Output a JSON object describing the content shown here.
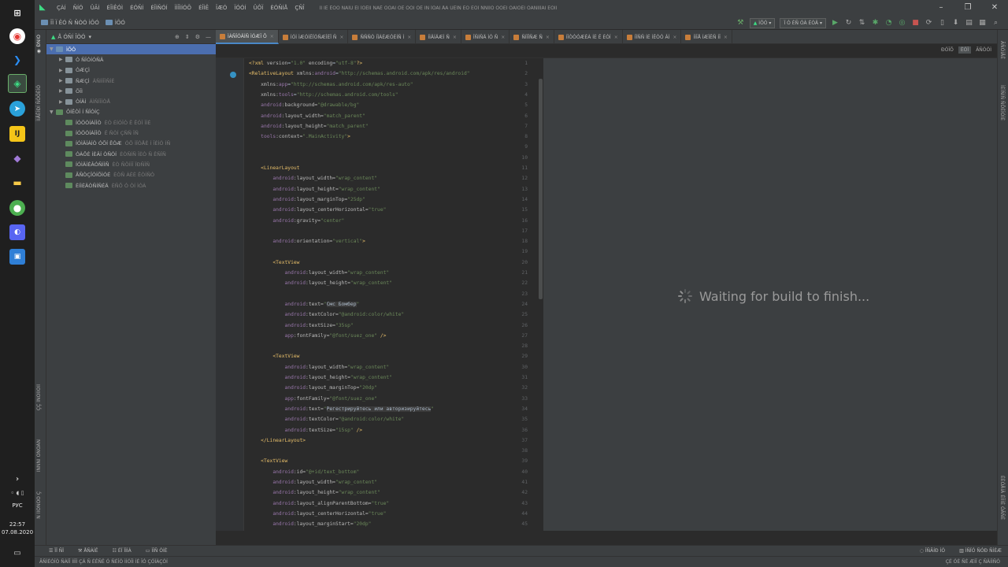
{
  "taskbar": {
    "language": "РУС",
    "time": "22:57",
    "date": "07.08.2020"
  },
  "menu": {
    "title": "ÏÌ ÍÈ ËÒÓ ÑÀÏÛ ÈÍ ÏÒËÎÌ ÑÀË ÓÓÀÍ ÓÉ ÓÒÌ ÓÊ ÌÑ ÏÒÁÌ ÅÂ ÛÊÏÑ ÈÒ ÈÓÏ ÑÑÌÎÕ ÓÒÊÌ ÓÁÍÓÊÌ ÓÀÑÎÍÏÁÍ ÈÓÍÍ"
  },
  "nav": {
    "crumb1": "ÏÏ Ï ÊÓ Ñ ÑÒÓ ÌÕÓ",
    "crumb2": "ÌÕÓ",
    "run_config": "ÌÕÓ",
    "device": "Ï Ó ÈÑ ÓÀ ÉÓÄ"
  },
  "project_panel": {
    "title": "Å ÓÑÍ ÎÒÓ",
    "tree": [
      {
        "label": "ÌÕÓ",
        "sel": true,
        "open": true,
        "depth": 0,
        "icon": "blue"
      },
      {
        "label": "Ó ÑÎÓÍÓÑÄ",
        "depth": 1,
        "icon": "plain"
      },
      {
        "label": "ÓÆÇÌ",
        "depth": 1,
        "icon": "plain"
      },
      {
        "label": "ÑÆÇÌ",
        "dim": "ÄÑÍÍÎÌÑÍÈ",
        "depth": 1,
        "icon": "plain"
      },
      {
        "label": "ÕÎÌ",
        "depth": 1,
        "icon": "plain"
      },
      {
        "label": "ÒÍÄÌ",
        "dim": "ÄÌÑÍÎÌÒÅ",
        "depth": 1,
        "icon": "plain"
      },
      {
        "label": "ÔÍÊÒÎ Í ÑÏÓÍÇ",
        "open": true,
        "depth": 0,
        "icon": "gradle"
      },
      {
        "label": "ÍÓÖÓÍÀÌÎÒ",
        "dim": "ÈÒ ÉÍÓÎÒ Ê ÊÓÎ ÎÍÈ",
        "depth": 1,
        "icon": "gradle"
      },
      {
        "label": "ÍÓÖÓÍÀÌÎÒ",
        "dim": "Ê ÑÒÍ ÇÑÑ ÎÑ",
        "depth": 1,
        "icon": "gradle"
      },
      {
        "label": "ÍÓÌÄÍÁÍÒ ÓÕÍ ÊÓÆ",
        "dim": "ÓÕ ÌÏÒÅÈ Í ÎÉÌÓ ÍÑ",
        "depth": 1,
        "icon": "gradle"
      },
      {
        "label": "ÓÀÔÈ ÍÈÂÍ ÒÑÓÍ",
        "dim": "ÈÒÑÍÑ ÎÈÒ Ñ ÊÑÎÑ",
        "depth": 1,
        "icon": "gradle"
      },
      {
        "label": "ÍÓÌÄÍÉÂÓÑÍÍÑ",
        "dim": "ÈÒ ÑÖÍÍÎ ÏÐÑÎÑ",
        "depth": 1,
        "icon": "gradle"
      },
      {
        "label": "ÃÑÒÇÎÓÍÕÌÓÉ",
        "dim": "ÈÒÑ ÁÈÈ ÊÒÍÑÓ",
        "depth": 1,
        "icon": "gradle"
      },
      {
        "label": "ÈÍÌÈÄÒÑÍÑÉÄ",
        "dim": "ÈÑÕ Ó ÒÍ ÌÓÀ",
        "depth": 1,
        "icon": "gradle"
      }
    ]
  },
  "tabs": [
    {
      "label": "ÌÀÑÎÓÄÍÑ ÌÓÆÎ Ô",
      "active": true
    },
    {
      "label": "ÍÓÌ ÌÆÓÍÊÏÓÑÆÎÈÏ Ñ"
    },
    {
      "label": "ÑÑÑÒ ÍÏÁÈÆÓÈÍÑ Ì"
    },
    {
      "label": "ÍÌÄÍÄÆÌ Ñ"
    },
    {
      "label": "ÎÑÍÑÄ ÌÓ Ñ"
    },
    {
      "label": "ÑÍÏÎÑÆ Ñ"
    },
    {
      "label": "ÍÏÒÒÓÆÈÀ ÍÈ Ê ÈÓÍ"
    },
    {
      "label": "ÍÏÑÑ ÍÉ ÍÊÒÓ ÂÍ"
    },
    {
      "label": "ÍÌÎÅ ÍÆÎÊÑ ÍÎ"
    }
  ],
  "modes": [
    "ÐÓÎÕ",
    "ÈÓÎ",
    "ÃÑÒÓÌ"
  ],
  "editor": {
    "lines": [
      {
        "n": "1",
        "h": "<span class=\"t\">&lt;?xml</span> <span class=\"a\">version</span>=<span class=\"v\">\"1.0\"</span> <span class=\"a\">encoding</span>=<span class=\"v\">\"utf-8\"</span><span class=\"t\">?&gt;</span>"
      },
      {
        "n": "2",
        "h": "<span class=\"t\">&lt;RelativeLayout</span> <span class=\"a\">xmlns:</span><span class=\"ns\">android</span>=<span class=\"v\">\"http://schemas.android.com/apk/res/android\"</span>",
        "m": true
      },
      {
        "n": "3",
        "h": "    <span class=\"a\">xmlns:</span><span class=\"ns\">app</span>=<span class=\"v\">\"http://schemas.android.com/apk/res-auto\"</span>"
      },
      {
        "n": "4",
        "h": "    <span class=\"a\">xmlns:</span><span class=\"ns\">tools</span>=<span class=\"v\">\"http://schemas.android.com/tools\"</span>"
      },
      {
        "n": "5",
        "h": "    <span class=\"ns\">android</span><span class=\"a\">:background=</span><span class=\"v\">\"@drawable/bg\"</span>"
      },
      {
        "n": "6",
        "h": "    <span class=\"ns\">android</span><span class=\"a\">:layout_width=</span><span class=\"v\">\"match_parent\"</span>"
      },
      {
        "n": "7",
        "h": "    <span class=\"ns\">android</span><span class=\"a\">:layout_height=</span><span class=\"v\">\"match_parent\"</span>"
      },
      {
        "n": "8",
        "h": "    <span class=\"ns\">tools</span><span class=\"a\">:context=</span><span class=\"v\">\".MainActivity\"</span><span class=\"t\">&gt;</span>"
      },
      {
        "n": "9",
        "h": ""
      },
      {
        "n": "10",
        "h": ""
      },
      {
        "n": "11",
        "h": "    <span class=\"t\">&lt;LinearLayout</span>"
      },
      {
        "n": "12",
        "h": "        <span class=\"ns\">android</span><span class=\"a\">:layout_width=</span><span class=\"v\">\"wrap_content\"</span>"
      },
      {
        "n": "13",
        "h": "        <span class=\"ns\">android</span><span class=\"a\">:layout_height=</span><span class=\"v\">\"wrap_content\"</span>"
      },
      {
        "n": "14",
        "h": "        <span class=\"ns\">android</span><span class=\"a\">:layout_marginTop=</span><span class=\"v\">\"25dp\"</span>"
      },
      {
        "n": "15",
        "h": "        <span class=\"ns\">android</span><span class=\"a\">:layout_centerHorizontal=</span><span class=\"v\">\"true\"</span>"
      },
      {
        "n": "16",
        "h": "        <span class=\"ns\">android</span><span class=\"a\">:gravity=</span><span class=\"v\">\"center\"</span>"
      },
      {
        "n": "17",
        "h": ""
      },
      {
        "n": "18",
        "h": "        <span class=\"ns\">android</span><span class=\"a\">:orientation=</span><span class=\"v\">\"vertical\"</span><span class=\"t\">&gt;</span>"
      },
      {
        "n": "19",
        "h": ""
      },
      {
        "n": "20",
        "h": "        <span class=\"t\">&lt;TextView</span>"
      },
      {
        "n": "21",
        "h": "            <span class=\"ns\">android</span><span class=\"a\">:layout_width=</span><span class=\"v\">\"wrap_content\"</span>"
      },
      {
        "n": "22",
        "h": "            <span class=\"ns\">android</span><span class=\"a\">:layout_height=</span><span class=\"v\">\"wrap_content\"</span>"
      },
      {
        "n": "23",
        "h": ""
      },
      {
        "n": "24",
        "h": "            <span class=\"ns\">android</span><span class=\"a\">:text=</span><span class=\"v\">\"<span class=\"hl\">Смс Бомбер</span>\"</span>"
      },
      {
        "n": "25",
        "h": "            <span class=\"ns\">android</span><span class=\"a\">:textColor=</span><span class=\"v\">\"@android:color/white\"</span>"
      },
      {
        "n": "26",
        "h": "            <span class=\"ns\">android</span><span class=\"a\">:textSize=</span><span class=\"v\">\"35sp\"</span>"
      },
      {
        "n": "27",
        "h": "            <span class=\"ns\">app</span><span class=\"a\">:fontFamily=</span><span class=\"v\">\"@font/suez_one\"</span> <span class=\"t\">/&gt;</span>"
      },
      {
        "n": "28",
        "h": ""
      },
      {
        "n": "29",
        "h": "        <span class=\"t\">&lt;TextView</span>"
      },
      {
        "n": "30",
        "h": "            <span class=\"ns\">android</span><span class=\"a\">:layout_width=</span><span class=\"v\">\"wrap_content\"</span>"
      },
      {
        "n": "31",
        "h": "            <span class=\"ns\">android</span><span class=\"a\">:layout_height=</span><span class=\"v\">\"wrap_content\"</span>"
      },
      {
        "n": "32",
        "h": "            <span class=\"ns\">android</span><span class=\"a\">:layout_marginTop=</span><span class=\"v\">\"20dp\"</span>"
      },
      {
        "n": "33",
        "h": "            <span class=\"ns\">app</span><span class=\"a\">:fontFamily=</span><span class=\"v\">\"@font/suez_one\"</span>"
      },
      {
        "n": "34",
        "h": "            <span class=\"ns\">android</span><span class=\"a\">:text=</span><span class=\"v\">\"<span class=\"hl\">Регестрируйтесь или авторизируйтесь</span>\"</span>"
      },
      {
        "n": "35",
        "h": "            <span class=\"ns\">android</span><span class=\"a\">:textColor=</span><span class=\"v\">\"@android:color/white\"</span>"
      },
      {
        "n": "36",
        "h": "            <span class=\"ns\">android</span><span class=\"a\">:textSize=</span><span class=\"v\">\"15sp\"</span> <span class=\"t\">/&gt;</span>"
      },
      {
        "n": "37",
        "h": "    <span class=\"t\">&lt;/LinearLayout&gt;</span>"
      },
      {
        "n": "38",
        "h": ""
      },
      {
        "n": "39",
        "h": "    <span class=\"t\">&lt;TextView</span>"
      },
      {
        "n": "40",
        "h": "        <span class=\"ns\">android</span><span class=\"a\">:id=</span><span class=\"v\">\"@+id/text_bottom\"</span>"
      },
      {
        "n": "41",
        "h": "        <span class=\"ns\">android</span><span class=\"a\">:layout_width=</span><span class=\"v\">\"wrap_content\"</span>"
      },
      {
        "n": "42",
        "h": "        <span class=\"ns\">android</span><span class=\"a\">:layout_height=</span><span class=\"v\">\"wrap_content\"</span>"
      },
      {
        "n": "43",
        "h": "        <span class=\"ns\">android</span><span class=\"a\">:layout_alignParentBottom=</span><span class=\"v\">\"true\"</span>"
      },
      {
        "n": "44",
        "h": "        <span class=\"ns\">android</span><span class=\"a\">:layout_centerHorizontal=</span><span class=\"v\">\"true\"</span>"
      },
      {
        "n": "45",
        "h": "        <span class=\"ns\">android</span><span class=\"a\">:layout_marginStart=</span><span class=\"v\">\"20dp\"</span>"
      }
    ]
  },
  "preview": {
    "message": "Waiting for build to finish..."
  },
  "left_strip": [
    "ÌÍÅÊÍÐÍ ÑÒÔÈÍÓ",
    "ÇÇ ÏÑÒÏÎÓÍÏ",
    "ÌÑÑÑÎ ÓÑÓÄÑ",
    "Ñ ÏÍÓÑÒÓ Ç"
  ],
  "right_strip": [
    "ÃÑÓÌÅÊ",
    "ÌÈÎÑÍÑ ÑÕÊÎÓÍÈ",
    "ÉÈÓÅÌÄ ÉÎÌÌÈ ÓÃÑÈ"
  ],
  "bottom": [
    "ÏÏ ÑÏ",
    "ÅÑÀÍÊ",
    "ÉÏ ÏÌÍÁ",
    "ÌÎÑ ÓÍÈ"
  ],
  "bottom_right": [
    "ÎÑÃÍÐ ÌÓ",
    "ÌÑÏÓ ÑÓÐ ÑÍÈÆ"
  ],
  "status": {
    "left": "ÃÑÌÈÓÎÒ ÑÀÏÎ ÌÍÎÍ ÇÄ Ñ ÉÊÑÊ Ó ÑÉÎÓ ÌÍÓÎÌ ÍÉ ÎÓ ÇÓÏÀÇÓÍ",
    "right": "ÇÉ ÓÈ ÑÉ ÆÍÎ Ç ÑÄÍÌÑÓ"
  }
}
